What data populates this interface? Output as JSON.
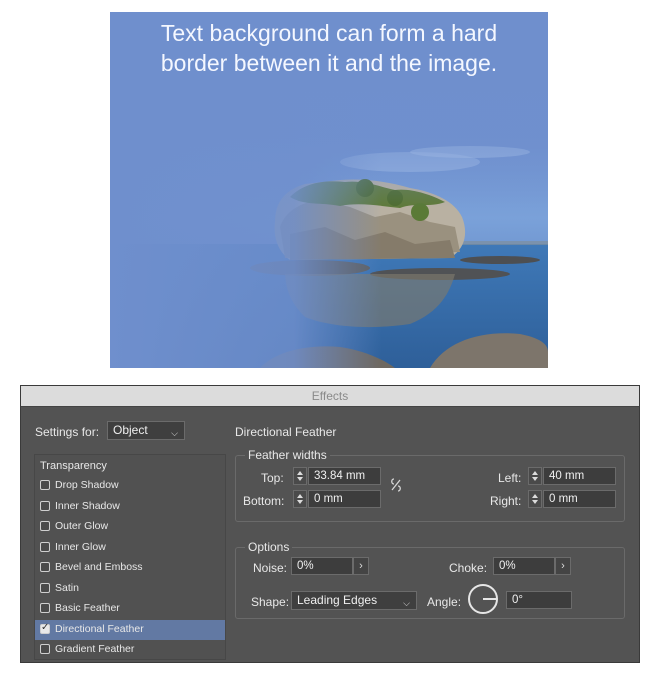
{
  "photo": {
    "caption_line1": "Text background can form a hard",
    "caption_line2": "border between it and the image."
  },
  "dialog": {
    "title": "Effects",
    "settings_for_label": "Settings for:",
    "settings_for_value": "Object",
    "section_title": "Directional Feather",
    "list_header": "Transparency",
    "effects_list": [
      {
        "label": "Drop Shadow",
        "checked": false
      },
      {
        "label": "Inner Shadow",
        "checked": false
      },
      {
        "label": "Outer Glow",
        "checked": false
      },
      {
        "label": "Inner Glow",
        "checked": false
      },
      {
        "label": "Bevel and Emboss",
        "checked": false
      },
      {
        "label": "Satin",
        "checked": false
      },
      {
        "label": "Basic Feather",
        "checked": false
      },
      {
        "label": "Directional Feather",
        "checked": true,
        "selected": true
      },
      {
        "label": "Gradient Feather",
        "checked": false
      }
    ],
    "feather_widths": {
      "group_title": "Feather widths",
      "top_label": "Top:",
      "top_value": "33.84 mm",
      "bottom_label": "Bottom:",
      "bottom_value": "0 mm",
      "left_label": "Left:",
      "left_value": "40 mm",
      "right_label": "Right:",
      "right_value": "0 mm",
      "link_icon": "unlink-icon"
    },
    "options": {
      "group_title": "Options",
      "noise_label": "Noise:",
      "noise_value": "0%",
      "choke_label": "Choke:",
      "choke_value": "0%",
      "shape_label": "Shape:",
      "shape_value": "Leading Edges",
      "angle_label": "Angle:",
      "angle_value": "0°"
    }
  },
  "colors": {
    "dialog_bg": "#535353",
    "selection": "#6279a3",
    "titlebar": "#dcdcdc"
  }
}
